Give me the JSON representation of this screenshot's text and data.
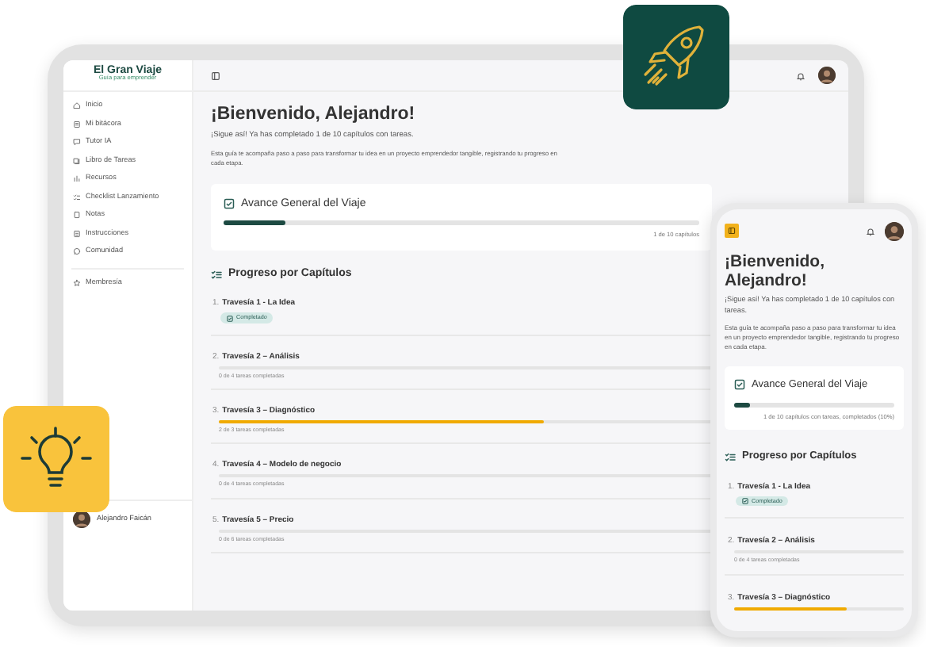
{
  "tablet": {
    "sidebar": {
      "brand": "El Gran Viaje",
      "tagline": "Guía para emprender",
      "items": [
        {
          "label": "Inicio"
        },
        {
          "label": "Mi bitácora"
        },
        {
          "label": "Tutor IA"
        },
        {
          "label": "Libro de Tareas"
        },
        {
          "label": "Recursos"
        },
        {
          "label": "Checklist Lanzamiento"
        },
        {
          "label": "Notas"
        },
        {
          "label": "Instrucciones"
        },
        {
          "label": "Comunidad"
        }
      ],
      "extra_items": [
        {
          "label": "Membresía"
        }
      ],
      "user": {
        "name": "Alejandro Faicán"
      }
    },
    "main": {
      "title": "¡Bienvenido, Alejandro!",
      "subtitle": "¡Sigue así! Ya has completado 1 de 10 capítulos con tareas.",
      "intro": "Esta guía te acompaña paso a paso para transformar tu idea en un proyecto emprendedor tangible, registrando tu progreso en cada etapa.",
      "overall": {
        "title": "Avance General del Viaje",
        "level": 0.13,
        "caption": "1 de 10 capítulos"
      },
      "chapters_title": "Progreso por Capítulos",
      "chapters": [
        {
          "number": "1.",
          "title": "Travesía 1 - La Idea",
          "kind": "completed",
          "badge": "Completado"
        },
        {
          "number": "2.",
          "title": "Travesía 2 – Análisis",
          "kind": "progress",
          "level": 0,
          "caption": "0 de 4 tareas completadas"
        },
        {
          "number": "3.",
          "title": "Travesía 3 – Diagnóstico",
          "kind": "progress",
          "level": 0.66,
          "caption": "2 de 3 tareas completadas"
        },
        {
          "number": "4.",
          "title": "Travesía 4 – Modelo de negocio",
          "kind": "progress",
          "level": 0,
          "caption": "0 de 4 tareas completadas"
        },
        {
          "number": "5.",
          "title": "Travesía 5 – Precio",
          "kind": "progress",
          "level": 0,
          "caption": "0 de 6 tareas completadas"
        }
      ]
    }
  },
  "phone": {
    "title": "¡Bienvenido, Alejandro!",
    "subtitle": "¡Sigue así! Ya has completado 1 de 10 capítulos con tareas.",
    "intro": "Esta guía te acompaña paso a paso para transformar tu idea en un proyecto emprendedor tangible, registrando tu progreso en cada etapa.",
    "overall": {
      "title": "Avance General del Viaje",
      "level": 0.1,
      "caption": "1 de 10 capítulos con tareas, completados (10%)"
    },
    "chapters_title": "Progreso por Capítulos",
    "chapters": [
      {
        "number": "1.",
        "title": "Travesía 1 - La Idea",
        "kind": "completed",
        "badge": "Completado"
      },
      {
        "number": "2.",
        "title": "Travesía 2 – Análisis",
        "kind": "progress",
        "level": 0,
        "caption": "0 de 4 tareas completadas"
      },
      {
        "number": "3.",
        "title": "Travesía 3 – Diagnóstico",
        "kind": "progress",
        "level": 0.66
      }
    ]
  }
}
